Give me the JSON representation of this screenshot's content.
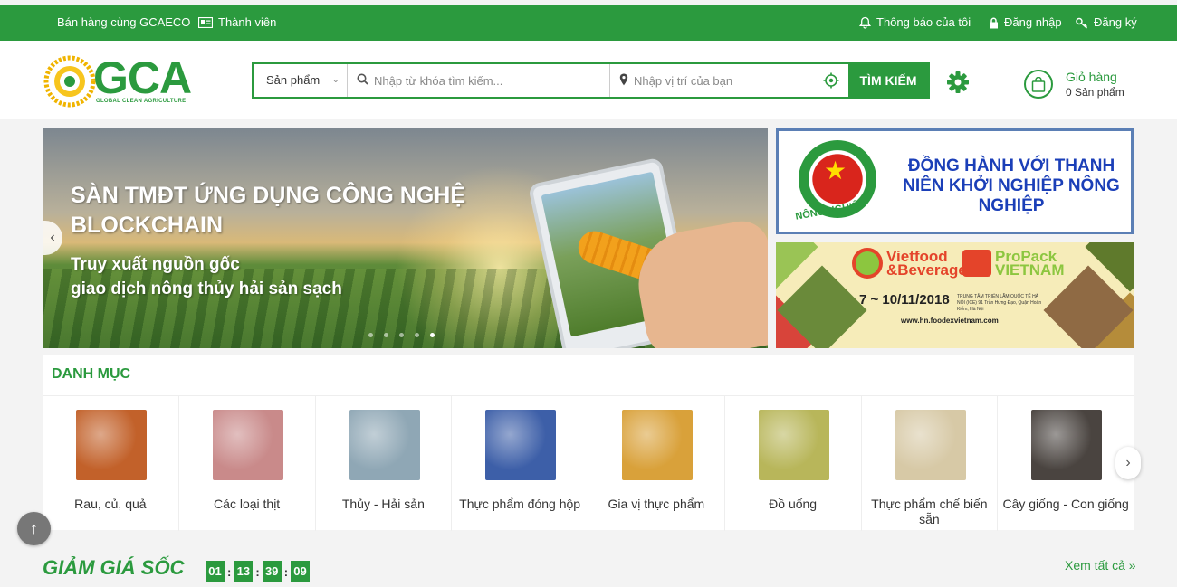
{
  "topbar": {
    "sell_label": "Bán hàng cùng GCAECO",
    "member_label": "Thành viên",
    "notify_label": "Thông báo của tôi",
    "login_label": "Đăng nhập",
    "register_label": "Đăng ký"
  },
  "header": {
    "logo_text": "GCA",
    "logo_tagline": "GLOBAL CLEAN AGRICULTURE",
    "search": {
      "category_value": "Sản phẩm",
      "keyword_placeholder": "Nhập từ khóa tìm kiếm...",
      "location_placeholder": "Nhập vị trí của bạn",
      "button_label": "TÌM KIẾM"
    },
    "cart": {
      "title": "Giỏ hàng",
      "count_text": "0 Sản phẩm"
    }
  },
  "banner": {
    "headline": "SÀN TMĐT ỨNG DỤNG CÔNG NGHỆ BLOCKCHAIN",
    "subline_1": "Truy xuất nguồn gốc",
    "subline_2": "giao dịch nông thủy hải sản sạch",
    "slide_count": 5,
    "active_slide": 5
  },
  "side_banner_1": {
    "emblem_text": "NÔNG NGHIỆP",
    "message": "ĐỒNG HÀNH VỚI THANH NIÊN KHỞI NGHIỆP NÔNG NGHIỆP"
  },
  "side_banner_2": {
    "brand_1": "Vietfood &Beverage",
    "brand_2": "ProPack VIETNAM",
    "dates": "7 ~ 10/11/2018",
    "venue": "TRUNG TÂM TRIỂN LÃM QUỐC TẾ HÀ NỘI (ICE) 91 Trần Hưng Đạo, Quận Hoàn Kiếm, Hà Nội",
    "url": "www.hn.foodexvietnam.com"
  },
  "categories": {
    "title": "DANH MỤC",
    "items": [
      {
        "label": "Rau, củ, quả",
        "color": "#c2612a"
      },
      {
        "label": "Các loại thịt",
        "color": "#c98a8a"
      },
      {
        "label": "Thủy - Hải sản",
        "color": "#8fa7b5"
      },
      {
        "label": "Thực phẩm đóng hộp",
        "color": "#3d5fa8"
      },
      {
        "label": "Gia vị thực phẩm",
        "color": "#d9a13a"
      },
      {
        "label": "Đồ uống",
        "color": "#b8b65a"
      },
      {
        "label": "Thực phẩm chế biến sẵn",
        "color": "#d7c9a6"
      },
      {
        "label": "Cây giống - Con giống",
        "color": "#4a4440"
      }
    ]
  },
  "flash_sale": {
    "title": "GIẢM GIÁ SỐC",
    "hours": "01",
    "minutes": "13",
    "seconds": "39",
    "frames": "09",
    "view_all_label": "Xem tất cả »"
  },
  "colors": {
    "brand_green": "#2b9a3e",
    "background": "#f3f3f3",
    "heading_blue": "#1b3fb8"
  }
}
